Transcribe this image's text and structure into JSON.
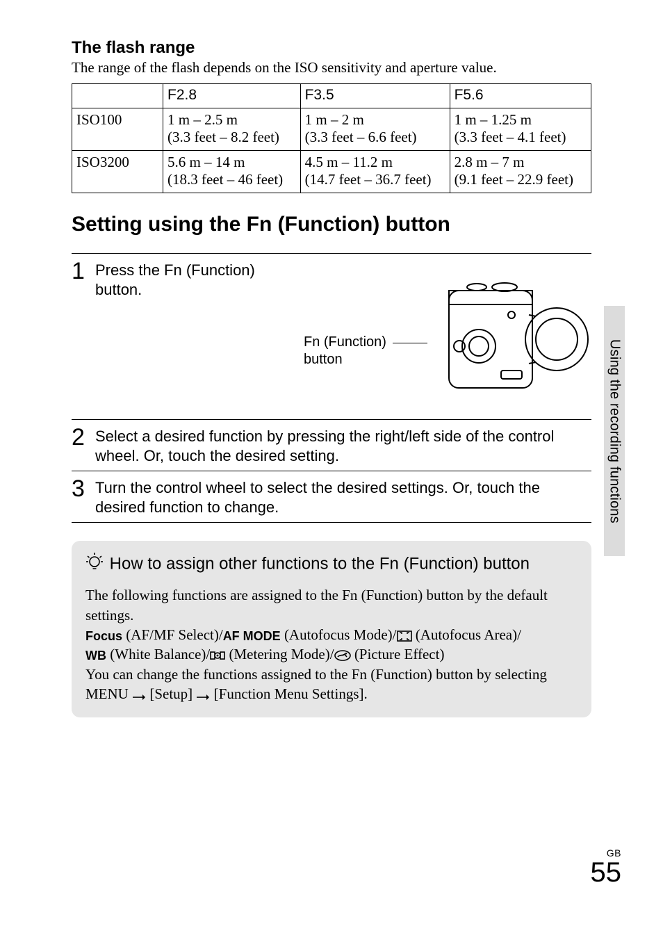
{
  "side_tab": "Using the recording functions",
  "page_locale": "GB",
  "page_number": "55",
  "flash": {
    "heading": "The flash range",
    "intro": "The range of the flash depends on the ISO sensitivity and aperture value.",
    "cols": [
      "",
      "F2.8",
      "F3.5",
      "F5.6"
    ],
    "rows": [
      {
        "label": "ISO100",
        "cells": [
          {
            "line1": "1 m – 2.5 m",
            "line2": "(3.3 feet – 8.2 feet)"
          },
          {
            "line1": "1 m – 2 m",
            "line2": "(3.3 feet – 6.6 feet)"
          },
          {
            "line1": "1 m – 1.25 m",
            "line2": "(3.3 feet – 4.1 feet)"
          }
        ]
      },
      {
        "label": "ISO3200",
        "cells": [
          {
            "line1": "5.6 m – 14 m",
            "line2": "(18.3 feet – 46 feet)"
          },
          {
            "line1": "4.5 m – 11.2 m",
            "line2": "(14.7 feet – 36.7 feet)"
          },
          {
            "line1": "2.8 m – 7 m",
            "line2": "(9.1 feet – 22.9 feet)"
          }
        ]
      }
    ]
  },
  "main_heading": "Setting using the Fn (Function) button",
  "steps": [
    {
      "num": "1",
      "text": "Press the Fn (Function) button.",
      "figure_label_line1": "Fn (Function)",
      "figure_label_line2": "button"
    },
    {
      "num": "2",
      "text": "Select a desired function by pressing the right/left side of the control wheel. Or, touch the desired setting."
    },
    {
      "num": "3",
      "text": "Turn the control wheel to select the desired settings. Or, touch the desired function to change."
    }
  ],
  "tip": {
    "title": "How to assign other functions to the Fn (Function) button",
    "p1": "The following functions are assigned to the Fn (Function) button by the default settings.",
    "focus_label": "Focus",
    "afmf": " (AF/MF Select)/",
    "afmode_label": "AF MODE",
    "afmode_after": " (Autofocus Mode)/",
    "afarea_after": " (Autofocus Area)/",
    "wb_label": "WB",
    "wb_after": " (White Balance)/",
    "metering_after": " (Metering Mode)/",
    "picture_after": " (Picture Effect)",
    "p3a": "You can change the functions assigned to the Fn (Function) button by selecting ",
    "p3_menu": "MENU",
    "p3_setup": " [Setup] ",
    "p3_fms": " [Function Menu Settings]."
  }
}
